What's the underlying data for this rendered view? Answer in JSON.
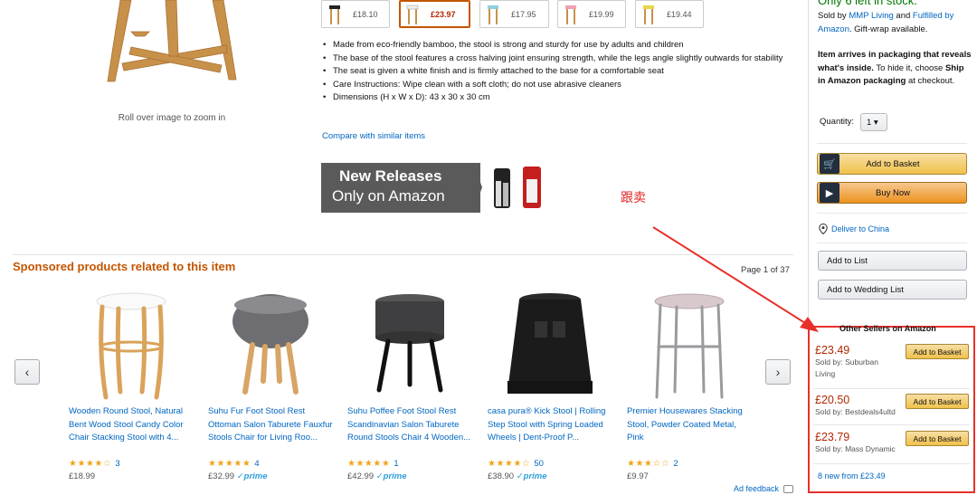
{
  "gallery": {
    "zoom_hint": "Roll over image to zoom in"
  },
  "variations": [
    {
      "price": "£18.10",
      "selected": false
    },
    {
      "price": "£23.97",
      "selected": true
    },
    {
      "price": "£17.95",
      "selected": false
    },
    {
      "price": "£19.99",
      "selected": false
    },
    {
      "price": "£19.44",
      "selected": false
    }
  ],
  "bullets": [
    "Made from eco-friendly bamboo, the stool is strong and sturdy for use by adults and children",
    "The base of the stool features a cross halving joint ensuring strength, while the legs angle slightly outwards for stability",
    "The seat is given a white finish and is firmly attached to the base for a comfortable seat",
    "Care Instructions: Wipe clean with a soft cloth; do not use abrasive cleaners",
    "Dimensions (H x W x D): 43 x 30 x 30 cm"
  ],
  "compare_link": "Compare with similar items",
  "banner": {
    "line1": "New Releases",
    "line2": "Only on Amazon"
  },
  "annotation": "跟卖",
  "sponsored": {
    "title": "Sponsored products related to this item",
    "page": "Page 1 of 37",
    "prev_icon": "chevron-left-icon",
    "next_icon": "chevron-right-icon",
    "products": [
      {
        "title": "Wooden Round Stool, Natural Bent Wood Stool Candy Color Chair Stacking Stool with 4...",
        "stars": "★★★★☆",
        "rating": 4.5,
        "reviews": "3",
        "price": "£18.99",
        "prime": ""
      },
      {
        "title": "Suhu Fur Foot Stool Rest Ottoman Salon Taburete Fauxfur Stools Chair for Living Roo...",
        "stars": "★★★★★",
        "rating": 5,
        "reviews": "4",
        "price": "£32.99",
        "prime": "✓prime"
      },
      {
        "title": "Suhu Poffee Foot Stool Rest Scandinavian Salon Taburete Round Stools Chair 4 Wooden...",
        "stars": "★★★★★",
        "rating": 5,
        "reviews": "1",
        "price": "£42.99",
        "prime": "✓prime"
      },
      {
        "title": "casa pura® Kick Stool | Rolling Step Stool with Spring Loaded Wheels | Dent-Proof P...",
        "stars": "★★★★☆",
        "rating": 4.5,
        "reviews": "50",
        "price": "£38.90",
        "prime": "✓prime"
      },
      {
        "title": "Premier Housewares Stacking Stool, Powder Coated Metal, Pink",
        "stars": "★★★☆☆",
        "rating": 3,
        "reviews": "2",
        "price": "£9.97",
        "prime": ""
      }
    ]
  },
  "ad_feedback": "Ad feedback",
  "buybox": {
    "stock": "Only 6 left in stock.",
    "sold_prefix": "Sold by ",
    "seller": "MMP Living",
    "sold_mid": " and ",
    "fulfilled": "Fulfilled by Amazon",
    "sold_suffix": ". Gift-wrap available.",
    "pkg_bold": "Item arrives in packaging that reveals what's inside.",
    "pkg_mid": " To hide it, choose ",
    "pkg_bold2": "Ship in Amazon packaging",
    "pkg_suffix": " at checkout.",
    "qty_label": "Quantity:",
    "qty_value": "1 ▾",
    "add_basket": "Add to Basket",
    "buy_now": "Buy Now",
    "deliver": "Deliver to China",
    "add_list": "Add to List",
    "add_wedding": "Add to Wedding List"
  },
  "other_sellers": {
    "title": "Other Sellers on Amazon",
    "offers": [
      {
        "price": "£23.49",
        "seller": "Sold by: Suburban Living",
        "button": "Add to Basket"
      },
      {
        "price": "£20.50",
        "seller": "Sold by: Bestdeals4ultd",
        "button": "Add to Basket"
      },
      {
        "price": "£23.79",
        "seller": "Sold by: Mass Dynamic",
        "button": "Add to Basket"
      }
    ],
    "new_from": "8 new from £23.49"
  },
  "colors": {
    "accent_orange": "#c45500",
    "link_blue": "#0066c0",
    "price_red": "#b12704",
    "annotation_red": "#e8302a",
    "stock_green": "#007600"
  }
}
